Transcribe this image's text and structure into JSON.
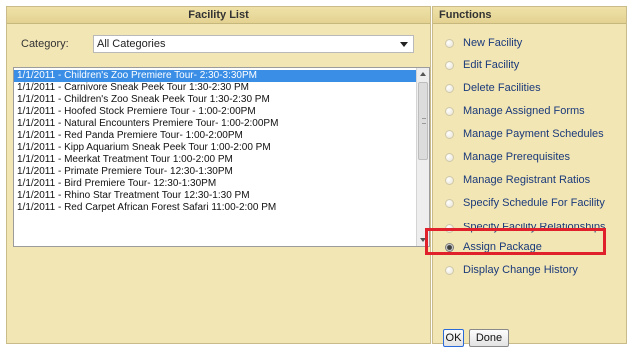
{
  "facility_panel": {
    "title": "Facility List",
    "category_label": "Category:",
    "category_value": "All Categories",
    "items": [
      "1/1/2011 - Children's Zoo Premiere Tour- 2:30-3:30PM",
      "1/1/2011 - Carnivore Sneak Peek Tour 1:30-2:30 PM",
      "1/1/2011 - Children's Zoo Sneak Peek Tour 1:30-2:30 PM",
      "1/1/2011 - Hoofed Stock Premiere Tour - 1:00-2:00PM",
      "1/1/2011 - Natural Encounters Premiere Tour- 1:00-2:00PM",
      "1/1/2011 - Red Panda Premiere Tour- 1:00-2:00PM",
      "1/1/2011 - Kipp Aquarium Sneak Peek Tour 1:00-2:00 PM",
      "1/1/2011 - Meerkat Treatment Tour 1:00-2:00 PM",
      "1/1/2011 - Primate Premiere Tour- 12:30-1:30PM",
      "1/1/2011 - Bird Premiere Tour- 12:30-1:30PM",
      "1/1/2011 - Rhino Star Treatment Tour 12:30-1:30 PM",
      "1/1/2011 - Red Carpet African Forest Safari 11:00-2:00 PM"
    ],
    "selected_index": 0
  },
  "functions_panel": {
    "title": "Functions",
    "options": [
      "New Facility",
      "Edit Facility",
      "Delete Facilities",
      "Manage Assigned Forms",
      "Manage Payment Schedules",
      "Manage Prerequisites",
      "Manage Registrant Ratios",
      "Specify Schedule For Facility",
      "Specify Facility Relationships",
      "Assign Package",
      "Display Change History"
    ],
    "checked_index": 9,
    "highlight_color": "#e0202a"
  },
  "buttons": {
    "ok_label": "OK",
    "done_label": "Done"
  },
  "colors": {
    "panel_background": "#f3e6b5",
    "selection": "#3a8ee6",
    "function_text": "#1a3a7a"
  }
}
